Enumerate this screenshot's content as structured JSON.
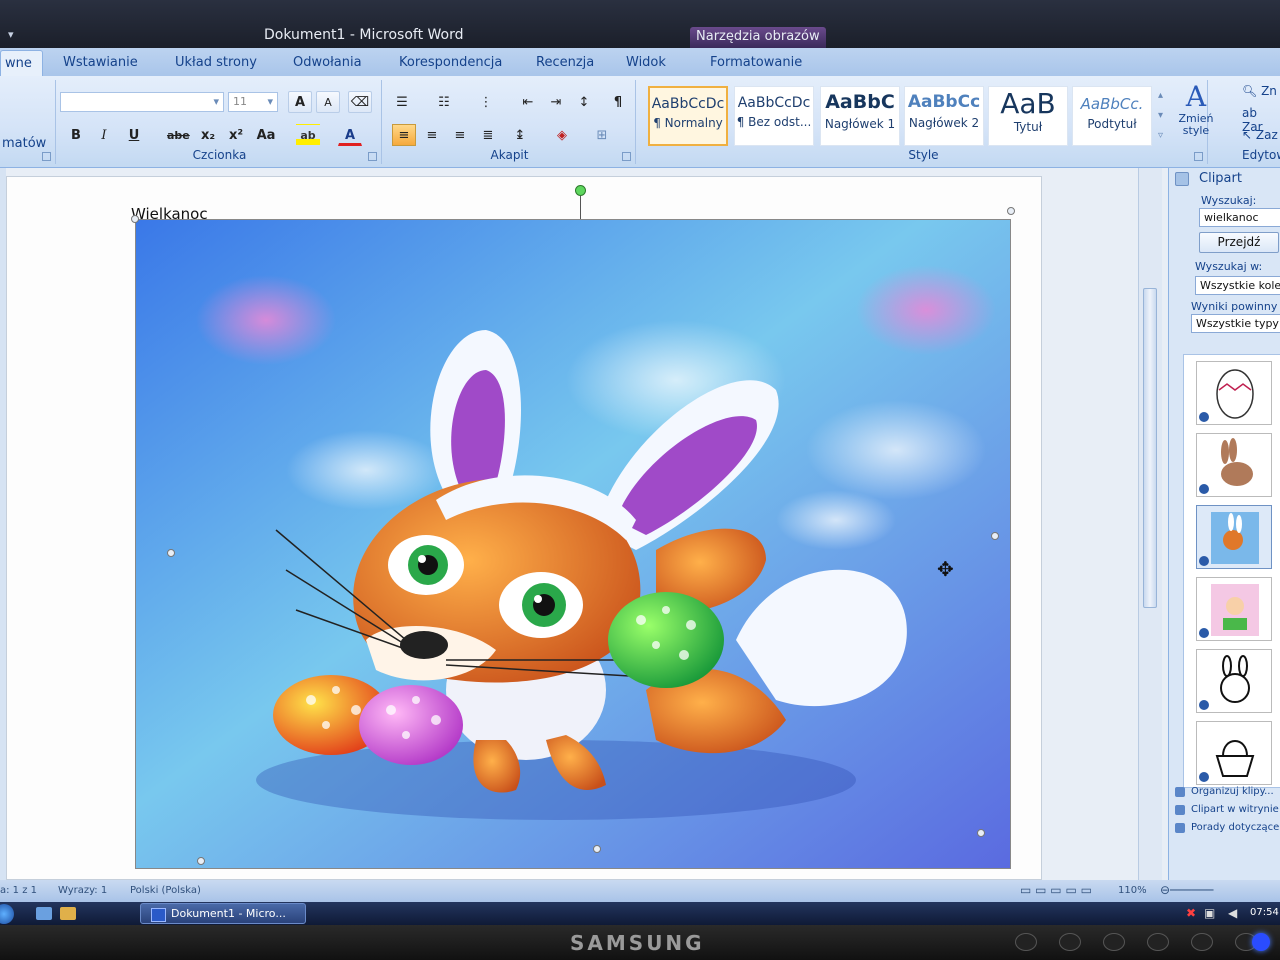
{
  "titlebar": {
    "title": "Dokument1 - Microsoft Word",
    "tools": "Narzędzia obrazów"
  },
  "tabs": [
    {
      "label": "wne"
    },
    {
      "label": "Wstawianie"
    },
    {
      "label": "Układ strony"
    },
    {
      "label": "Odwołania"
    },
    {
      "label": "Korespondencja"
    },
    {
      "label": "Recenzja"
    },
    {
      "label": "Widok"
    },
    {
      "label": "Formatowanie"
    }
  ],
  "ribbon": {
    "clipboard_label": "matów",
    "font_group": "Czcionka",
    "paragraph_group": "Akapit",
    "styles_group": "Style",
    "edit_group": "Edytow",
    "font_size": "11",
    "font_buttons": {
      "bold": "B",
      "italic": "I",
      "underline": "U",
      "strike": "abe",
      "sub": "x₂",
      "sup": "x²",
      "case": "Aa",
      "grow": "A",
      "shrink": "A",
      "color": "A"
    },
    "styles": [
      {
        "sample": "AaBbCcDc",
        "name": "¶ Normalny"
      },
      {
        "sample": "AaBbCcDc",
        "name": "¶ Bez odst..."
      },
      {
        "sample": "AaBbC",
        "name": "Nagłówek 1"
      },
      {
        "sample": "AaBbCc",
        "name": "Nagłówek 2"
      },
      {
        "sample": "AaB",
        "name": "Tytuł"
      },
      {
        "sample": "AaBbCc.",
        "name": "Podtytuł"
      }
    ],
    "change_styles": "Zmień style",
    "edit_items": [
      "Zn",
      "Zar",
      "Zaz"
    ]
  },
  "document": {
    "heading": "Wielkanoc"
  },
  "clipart": {
    "title": "Clipart",
    "search_label": "Wyszukaj:",
    "search_value": "wielkanoc",
    "go_button": "Przejdź",
    "search_in_label": "Wyszukaj w:",
    "search_in_value": "Wszystkie kolek",
    "results_label": "Wyniki powinny r",
    "results_value": "Wszystkie typy",
    "links": [
      "Organizuj klipy...",
      "Clipart w witrynie Offic",
      "Porady dotyczące znaj"
    ]
  },
  "status": {
    "page": "a: 1 z 1",
    "words": "Wyrazy: 1",
    "lang": "Polski (Polska)",
    "zoom": "110%"
  },
  "taskbar": {
    "item": "Dokument1 - Micro...",
    "clock": "07:54"
  },
  "bezel": {
    "brand": "SAMSUNG"
  }
}
